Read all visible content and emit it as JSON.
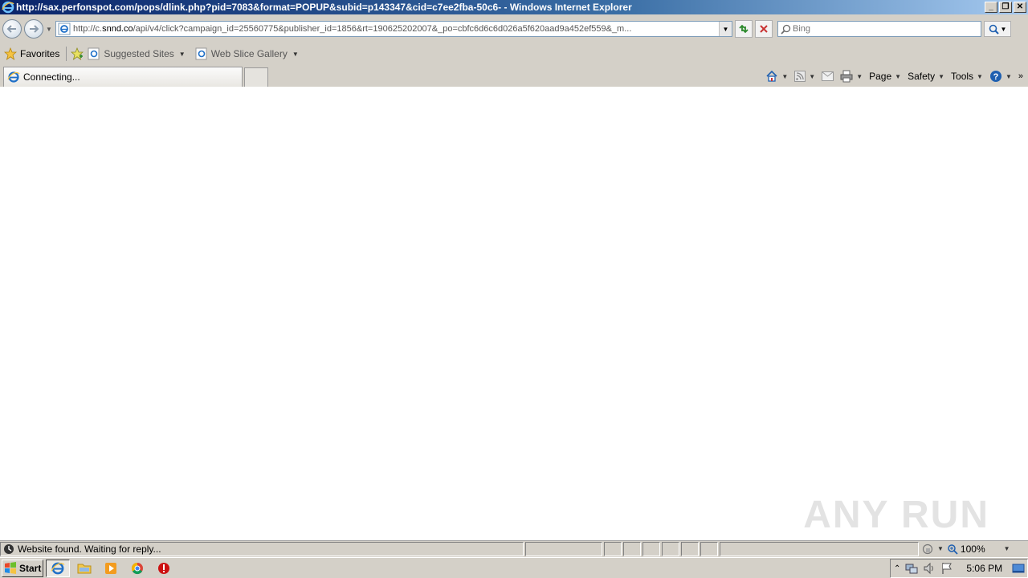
{
  "window": {
    "title": "http://sax.perfonspot.com/pops/dlink.php?pid=7083&format=POPUP&subid=p143347&cid=c7ee2fba-50c6- - Windows Internet Explorer",
    "min_label": "_",
    "restore_label": "❐",
    "close_label": "✕"
  },
  "address": {
    "url_prefix": "http://c.",
    "url_domain": "snnd.co",
    "url_rest": "/api/v4/click?campaign_id=25560775&publisher_id=1856&rt=190625202007&_po=cbfc6d6c6d026a5f620aad9a452ef559&_m..."
  },
  "search": {
    "placeholder": "Bing"
  },
  "favorites": {
    "favorites_label": "Favorites",
    "suggested_label": "Suggested Sites",
    "webslice_label": "Web Slice Gallery"
  },
  "tab": {
    "label": "Connecting..."
  },
  "commandbar": {
    "page_label": "Page",
    "safety_label": "Safety",
    "tools_label": "Tools"
  },
  "status": {
    "text": "Website found. Waiting for reply...",
    "zoom": "100%"
  },
  "taskbar": {
    "start_label": "Start",
    "clock": "5:06 PM"
  },
  "watermark": {
    "text": "ANY RUN"
  },
  "colors": {
    "chrome": "#d4d0c8",
    "titlebar_start": "#0a246a",
    "titlebar_end": "#a6caf0",
    "ie_blue": "#1e6fc7"
  }
}
